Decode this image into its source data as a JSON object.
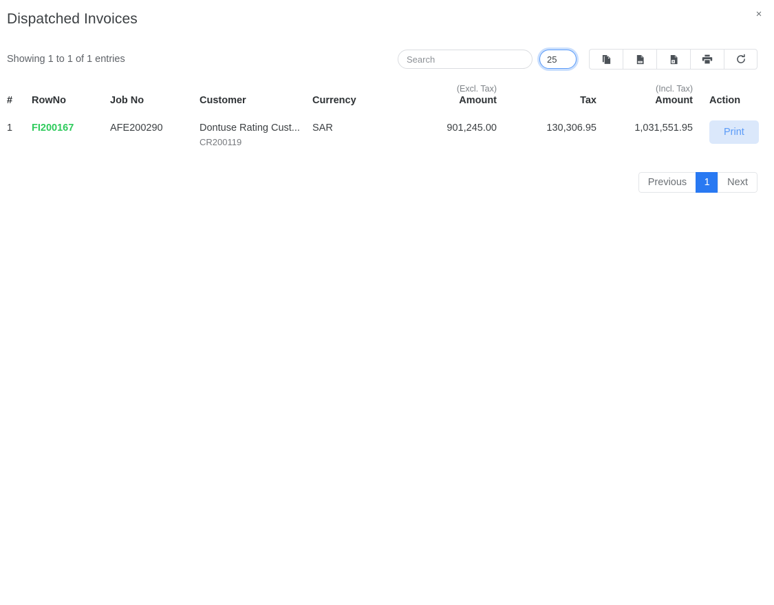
{
  "header": {
    "title": "Dispatched Invoices",
    "close_label": "×"
  },
  "toolbar": {
    "entries_info": "Showing 1 to 1 of 1 entries",
    "search": {
      "value": "",
      "placeholder": "Search"
    },
    "page_length": {
      "value": "25"
    },
    "buttons": [
      {
        "name": "copy-button",
        "icon": "copy-icon",
        "title": "Copy"
      },
      {
        "name": "csv-button",
        "icon": "csv-file-icon",
        "title": "CSV"
      },
      {
        "name": "excel-button",
        "icon": "excel-file-icon",
        "title": "Excel"
      },
      {
        "name": "print-toolbar-button",
        "icon": "printer-icon",
        "title": "Print"
      },
      {
        "name": "refresh-button",
        "icon": "refresh-icon",
        "title": "Refresh"
      }
    ]
  },
  "table": {
    "columns": [
      {
        "label": "#",
        "sub": ""
      },
      {
        "label": "RowNo",
        "sub": ""
      },
      {
        "label": "Job No",
        "sub": ""
      },
      {
        "label": "Customer",
        "sub": ""
      },
      {
        "label": "Currency",
        "sub": ""
      },
      {
        "label": "Amount",
        "sub": "(Excl. Tax)"
      },
      {
        "label": "Tax",
        "sub": ""
      },
      {
        "label": "Amount",
        "sub": "(Incl. Tax)"
      },
      {
        "label": "Action",
        "sub": ""
      }
    ],
    "rows": [
      {
        "index": "1",
        "row_no": "FI200167",
        "job_no": "AFE200290",
        "customer_name": "Dontuse Rating Cust...",
        "customer_code": "CR200119",
        "currency": "SAR",
        "amount_excl_tax": "901,245.00",
        "tax": "130,306.95",
        "amount_incl_tax": "1,031,551.95",
        "action_label": "Print"
      }
    ]
  },
  "pagination": {
    "previous_label": "Previous",
    "current_page": "1",
    "next_label": "Next"
  },
  "colors": {
    "accent_blue": "#2979f2",
    "link_green": "#2ecb5c",
    "print_bg": "#dbe8fb",
    "print_text": "#5b9bf8"
  }
}
